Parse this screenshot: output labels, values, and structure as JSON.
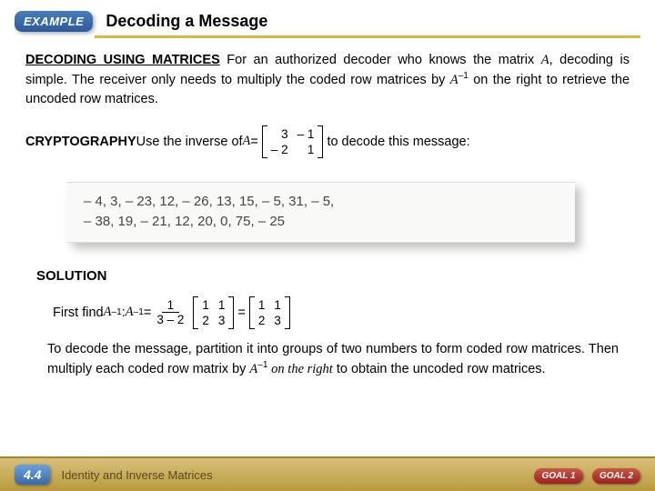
{
  "header": {
    "badge": "EXAMPLE",
    "title": "Decoding a Message"
  },
  "intro": {
    "lead": "DECODING USING MATRICES",
    "rest1": "  For an authorized decoder who knows the matrix ",
    "rest2": ", decoding is simple.  The receiver only needs to multiply the coded row matrices by ",
    "rest3": " on the right to retrieve the uncoded row matrices."
  },
  "crypto": {
    "lead": "CRYPTOGRAPHY",
    "use": "  Use the inverse of ",
    "eq": " = ",
    "matA": {
      "a": "3",
      "b": "– 1",
      "c": "– 2",
      "d": "1"
    },
    "tail": " to decode this message:"
  },
  "coded": {
    "l1": "– 4, 3, – 23, 12, – 26, 13, 15, – 5, 31, – 5,",
    "l2": "– 38, 19, – 21, 12, 20, 0, 75, – 25"
  },
  "solution": {
    "title": "SOLUTION",
    "first": "First find ",
    "colon": ":  ",
    "eq": " = ",
    "frac": {
      "top": "1",
      "bot": "3 – 2"
    },
    "m1": {
      "a": "1",
      "b": "1",
      "c": "2",
      "d": "3"
    },
    "eqsp": "  =  ",
    "m2": {
      "a": "1",
      "b": "1",
      "c": "2",
      "d": "3"
    },
    "para1": "To decode the message, partition it into groups of two numbers to form coded row matrices. Then multiply each coded row matrix by ",
    "para2": " on the right",
    "para3": " to obtain the uncoded row matrices."
  },
  "footer": {
    "sec": "4.4",
    "title": "Identity and Inverse Matrices",
    "g1": "GOAL 1",
    "g2": "GOAL 2"
  },
  "sym": {
    "A": "A",
    "Ainv_sup": "–1"
  }
}
